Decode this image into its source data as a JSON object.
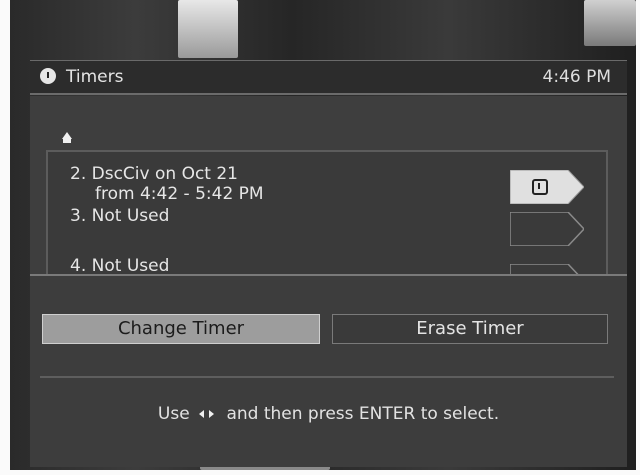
{
  "header": {
    "title": "Timers",
    "time": "4:46 PM",
    "icon": "clock-icon"
  },
  "timers": [
    {
      "number": "2.",
      "line1": "DscCiv on Oct 21",
      "line2": "from 4:42 - 5:42 PM",
      "tab_icon": "clock-icon",
      "selected": true
    },
    {
      "number": "3.",
      "line1": "Not Used",
      "line2": "",
      "selected": false
    },
    {
      "number": "4.",
      "line1": "Not Used",
      "line2": "",
      "selected": false
    }
  ],
  "actions": {
    "change_label": "Change Timer",
    "erase_label": "Erase Timer",
    "selected": "change"
  },
  "help": {
    "prefix": "Use",
    "suffix": "and then press ENTER to select."
  },
  "colors": {
    "panel": "#3d3d3d",
    "selected_button": "#9d9d9d",
    "text": "#e4e4e4"
  }
}
